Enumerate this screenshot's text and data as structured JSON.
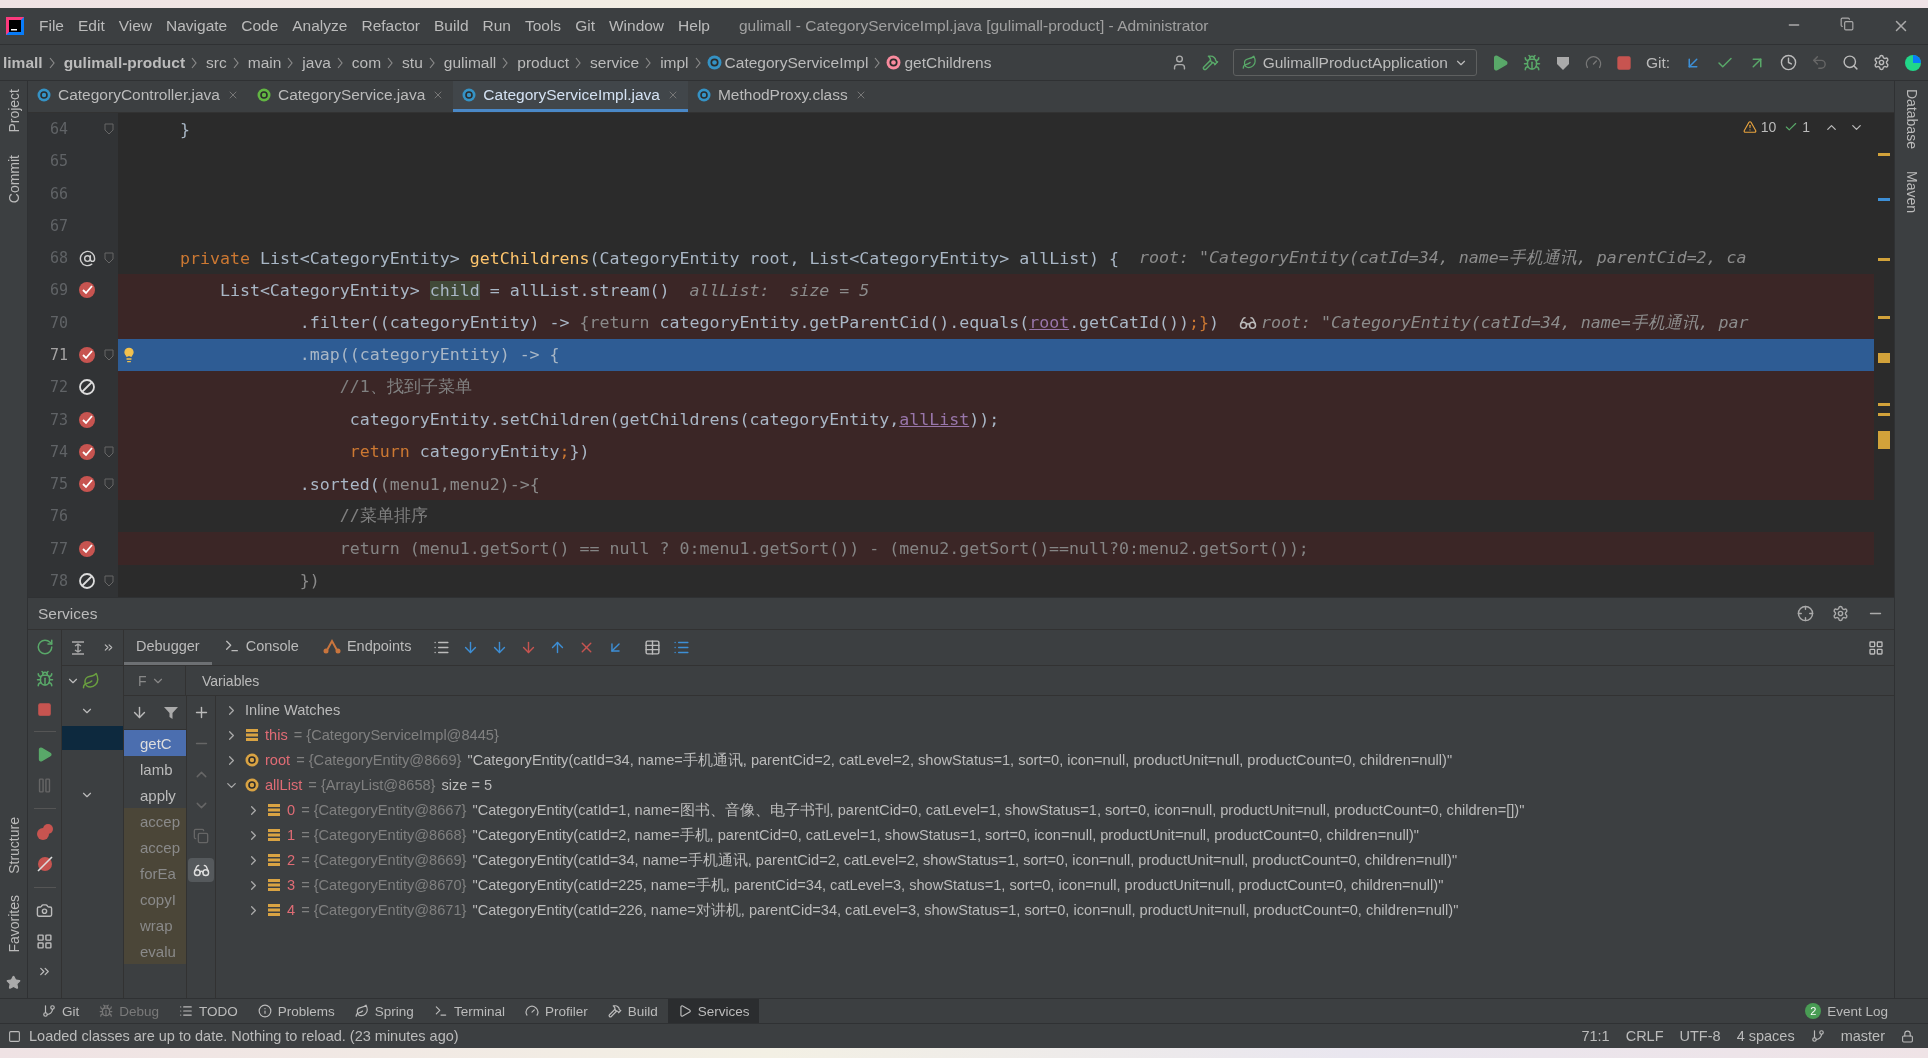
{
  "title_bar": {
    "menu": [
      "File",
      "Edit",
      "View",
      "Navigate",
      "Code",
      "Analyze",
      "Refactor",
      "Build",
      "Run",
      "Tools",
      "Git",
      "Window",
      "Help"
    ],
    "title": "gulimall - CategoryServiceImpl.java [gulimall-product] - Administrator"
  },
  "nav_bar": {
    "breadcrumbs": [
      {
        "text": "limall",
        "kind": "module"
      },
      {
        "text": "gulimall-product",
        "kind": "module"
      },
      {
        "text": "src",
        "kind": "folder"
      },
      {
        "text": "main",
        "kind": "folder"
      },
      {
        "text": "java",
        "kind": "folder"
      },
      {
        "text": "com",
        "kind": "folder"
      },
      {
        "text": "stu",
        "kind": "folder"
      },
      {
        "text": "gulimall",
        "kind": "folder"
      },
      {
        "text": "product",
        "kind": "folder"
      },
      {
        "text": "service",
        "kind": "folder"
      },
      {
        "text": "impl",
        "kind": "folder"
      },
      {
        "text": "CategoryServiceImpl",
        "kind": "class"
      },
      {
        "text": "getChildrens",
        "kind": "method"
      }
    ],
    "run_configuration": "GulimallProductApplication",
    "git_label": "Git:"
  },
  "side_panels": {
    "left_top": [
      "Project",
      "Commit"
    ],
    "left_bottom": [
      "Structure",
      "Favorites"
    ],
    "right": [
      "Database",
      "Maven"
    ]
  },
  "editor_tabs": [
    {
      "label": "CategoryController.java",
      "kind": "class",
      "selected": false
    },
    {
      "label": "CategoryService.java",
      "kind": "interface",
      "selected": false
    },
    {
      "label": "CategoryServiceImpl.java",
      "kind": "class",
      "selected": true
    },
    {
      "label": "MethodProxy.class",
      "kind": "compiled",
      "selected": false
    }
  ],
  "editor": {
    "inspections": {
      "warnings": "10",
      "passed": "1"
    },
    "lines": [
      {
        "number": "64",
        "kind": "plain",
        "fold": true,
        "bulb": false,
        "current": false,
        "highlighted": false,
        "tokens": [
          {
            "text": "    }",
            "kind": "plain"
          }
        ]
      },
      {
        "number": "65",
        "kind": "plain",
        "fold": false,
        "bulb": false,
        "current": false,
        "highlighted": false
      },
      {
        "number": "66",
        "kind": "plain",
        "fold": false,
        "bulb": false,
        "current": false,
        "highlighted": false
      },
      {
        "number": "67",
        "kind": "plain",
        "fold": false,
        "bulb": false,
        "current": false,
        "highlighted": false
      },
      {
        "number": "68",
        "kind": "override",
        "fold": true,
        "bulb": false,
        "current": false,
        "highlighted": false,
        "tokens": [
          {
            "text": "    private",
            "kind": "kw"
          },
          {
            "text": " List<CategoryEntity> ",
            "kind": "plain"
          },
          {
            "text": "getChildrens",
            "kind": "fn"
          },
          {
            "text": "(CategoryEntity root, List<CategoryEntity> allList) {",
            "kind": "plain"
          }
        ],
        "hint": {
          "text": "root: \"CategoryEntity(catId=34, name=手机通讯, parentCid=2, ca",
          "kind": "value"
        }
      },
      {
        "number": "69",
        "kind": "breakpoint",
        "fold": false,
        "bulb": false,
        "current": false,
        "highlighted": true,
        "tokens": [
          {
            "text": "        List<CategoryEntity> ",
            "kind": "plain"
          },
          {
            "text": "child",
            "kind": "highlight"
          },
          {
            "text": " = allList.stream()",
            "kind": "plain"
          }
        ],
        "hint": {
          "text": "allList:  size = 5",
          "kind": "value"
        }
      },
      {
        "number": "70",
        "kind": "plain",
        "fold": false,
        "bulb": false,
        "current": false,
        "highlighted": true,
        "tokens": [
          {
            "text": "                .filter((categoryEntity) -> ",
            "kind": "plain"
          },
          {
            "text": "{return ",
            "kind": "fold"
          },
          {
            "text": "categoryEntity.getParentCid().equals(",
            "kind": "plain"
          },
          {
            "text": "root",
            "kind": "ref"
          },
          {
            "text": ".getCatId())",
            "kind": "plain"
          },
          {
            "text": ";}",
            "kind": "kw"
          },
          {
            "text": ")",
            "kind": "plain"
          }
        ],
        "hint": {
          "text": "root: \"CategoryEntity(catId=34, name=手机通讯, par",
          "kind": "watch"
        }
      },
      {
        "number": "71",
        "kind": "breakpoint",
        "fold": true,
        "bulb": true,
        "current": true,
        "highlighted": false,
        "tokens": [
          {
            "text": "                .map((categoryEntity) -> {",
            "kind": "plain"
          }
        ]
      },
      {
        "number": "72",
        "kind": "disabled",
        "fold": false,
        "bulb": false,
        "current": false,
        "highlighted": true,
        "tokens": [
          {
            "text": "                    //1、找到子菜单",
            "kind": "comment"
          }
        ]
      },
      {
        "number": "73",
        "kind": "breakpoint",
        "fold": false,
        "bulb": false,
        "current": false,
        "highlighted": true,
        "tokens": [
          {
            "text": "                     categoryEntity.setChildren(getChildrens(categoryEntity,",
            "kind": "plain"
          },
          {
            "text": "allList",
            "kind": "ref"
          },
          {
            "text": "));",
            "kind": "plain"
          }
        ]
      },
      {
        "number": "74",
        "kind": "breakpoint",
        "fold": true,
        "bulb": false,
        "current": false,
        "highlighted": true,
        "tokens": [
          {
            "text": "                     return",
            "kind": "kw"
          },
          {
            "text": " categoryEntity",
            "kind": "plain"
          },
          {
            "text": ";",
            "kind": "kw"
          },
          {
            "text": "})",
            "kind": "plain"
          }
        ]
      },
      {
        "number": "75",
        "kind": "breakpoint",
        "fold": true,
        "bulb": false,
        "current": false,
        "highlighted": true,
        "tokens": [
          {
            "text": "                .sorted(",
            "kind": "plain"
          },
          {
            "text": "(menu1,menu2)->{",
            "kind": "fold"
          }
        ]
      },
      {
        "number": "76",
        "kind": "plain",
        "fold": false,
        "bulb": false,
        "current": false,
        "highlighted": false,
        "tokens": [
          {
            "text": "                    //菜单排序",
            "kind": "comment"
          }
        ]
      },
      {
        "number": "77",
        "kind": "breakpoint",
        "fold": false,
        "bulb": false,
        "current": false,
        "highlighted": true,
        "tokens": [
          {
            "text": "                    return (menu1.getSort() == null ? 0:menu1.getSort()) - (menu2.getSort()==null?0:menu2.getSort());",
            "kind": "dim"
          }
        ]
      },
      {
        "number": "78",
        "kind": "disabled",
        "fold": true,
        "bulb": false,
        "current": false,
        "highlighted": false,
        "tokens": [
          {
            "text": "                })",
            "kind": "fold"
          }
        ]
      }
    ]
  },
  "services": {
    "title": "Services",
    "tree": [
      {
        "kind": "app",
        "selected": false
      },
      {
        "kind": "group",
        "selected": false
      },
      {
        "kind": "leaf",
        "selected": true
      },
      {
        "kind": "leaf",
        "selected": false
      },
      {
        "kind": "group",
        "selected": false
      }
    ],
    "debugger_tabs": [
      {
        "label": "Debugger",
        "kind": "debugger",
        "selected": true
      },
      {
        "label": "Console",
        "kind": "console",
        "selected": false
      },
      {
        "label": "Endpoints",
        "kind": "endpoints",
        "selected": false
      }
    ],
    "frames_label": "F",
    "variables_label": "Variables",
    "frames": [
      {
        "text": "getC",
        "selected": true,
        "library": false
      },
      {
        "text": "lamb",
        "selected": false,
        "library": false
      },
      {
        "text": "apply",
        "selected": false,
        "library": false
      },
      {
        "text": "accep",
        "selected": false,
        "library": true
      },
      {
        "text": "accep",
        "selected": false,
        "library": true
      },
      {
        "text": "forEa",
        "selected": false,
        "library": true
      },
      {
        "text": "copyI",
        "selected": false,
        "library": true
      },
      {
        "text": "wrap",
        "selected": false,
        "library": true
      },
      {
        "text": "evalu",
        "selected": false,
        "library": true
      }
    ],
    "variables": [
      {
        "kind": "group",
        "name": "Inline Watches",
        "expanded": false
      },
      {
        "kind": "field",
        "name": "this",
        "ref": "= {CategoryServiceImpl@8445}",
        "expanded": false
      },
      {
        "kind": "param",
        "name": "root",
        "ref": "= {CategoryEntity@8669}",
        "value": "\"CategoryEntity(catId=34, name=手机通讯, parentCid=2, catLevel=2, showStatus=1, sort=0, icon=null, productUnit=null, productCount=0, children=null)\"",
        "expanded": false
      },
      {
        "kind": "param",
        "name": "allList",
        "ref": "= {ArrayList@8658}",
        "value": "size = 5",
        "expanded": true,
        "children": [
          {
            "kind": "field",
            "name": "0",
            "ref": "= {CategoryEntity@8667}",
            "value": "\"CategoryEntity(catId=1, name=图书、音像、电子书刊, parentCid=0, catLevel=1, showStatus=1, sort=0, icon=null, productUnit=null, productCount=0, children=[])\"",
            "expanded": false
          },
          {
            "kind": "field",
            "name": "1",
            "ref": "= {CategoryEntity@8668}",
            "value": "\"CategoryEntity(catId=2, name=手机, parentCid=0, catLevel=1, showStatus=1, sort=0, icon=null, productUnit=null, productCount=0, children=null)\"",
            "expanded": false
          },
          {
            "kind": "field",
            "name": "2",
            "ref": "= {CategoryEntity@8669}",
            "value": "\"CategoryEntity(catId=34, name=手机通讯, parentCid=2, catLevel=2, showStatus=1, sort=0, icon=null, productUnit=null, productCount=0, children=null)\"",
            "expanded": false
          },
          {
            "kind": "field",
            "name": "3",
            "ref": "= {CategoryEntity@8670}",
            "value": "\"CategoryEntity(catId=225, name=手机, parentCid=34, catLevel=3, showStatus=1, sort=0, icon=null, productUnit=null, productCount=0, children=null)\"",
            "expanded": false
          },
          {
            "kind": "field",
            "name": "4",
            "ref": "= {CategoryEntity@8671}",
            "value": "\"CategoryEntity(catId=226, name=对讲机, parentCid=34, catLevel=3, showStatus=1, sort=0, icon=null, productUnit=null, productCount=0, children=null)\"",
            "expanded": false
          }
        ]
      }
    ]
  },
  "tool_windows": [
    {
      "label": "Git",
      "kind": "git",
      "selected": false,
      "disabled": false
    },
    {
      "label": "Debug",
      "kind": "debug",
      "selected": false,
      "disabled": true
    },
    {
      "label": "TODO",
      "kind": "todo",
      "selected": false,
      "disabled": false
    },
    {
      "label": "Problems",
      "kind": "problems",
      "selected": false,
      "disabled": false
    },
    {
      "label": "Spring",
      "kind": "spring",
      "selected": false,
      "disabled": false
    },
    {
      "label": "Terminal",
      "kind": "terminal",
      "selected": false,
      "disabled": false
    },
    {
      "label": "Profiler",
      "kind": "profiler",
      "selected": false,
      "disabled": false
    },
    {
      "label": "Build",
      "kind": "build",
      "selected": false,
      "disabled": false
    },
    {
      "label": "Services",
      "kind": "services",
      "selected": true,
      "disabled": false
    }
  ],
  "event_log": {
    "label": "Event Log",
    "count": "2"
  },
  "status_bar": {
    "message": "Loaded classes are up to date. Nothing to reload. (23 minutes ago)",
    "position": "71:1",
    "line_separator": "CRLF",
    "encoding": "UTF-8",
    "indent": "4 spaces",
    "branch": "master"
  }
}
